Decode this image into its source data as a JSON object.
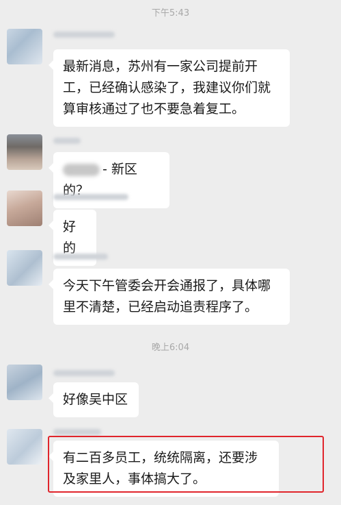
{
  "timestamps": [
    "下午5:43",
    "晚上6:04"
  ],
  "messages": [
    {
      "text": "最新消息，苏州有一家公司提前开工，已经确认感染了，我建议你们就算审核通过了也不要急着复工。"
    },
    {
      "text": "- 新区的？"
    },
    {
      "text": "好的"
    },
    {
      "text": "今天下午管委会开会通报了，具体哪里不清楚，已经启动追责程序了。"
    },
    {
      "text": "好像吴中区"
    },
    {
      "text": "有二百多员工，统统隔离，还要涉及家里人，事体搞大了。"
    }
  ],
  "colors": {
    "background": "#ededed",
    "bubble": "#ffffff",
    "highlight": "#e0242b",
    "timestamp": "#a8a8a8"
  }
}
